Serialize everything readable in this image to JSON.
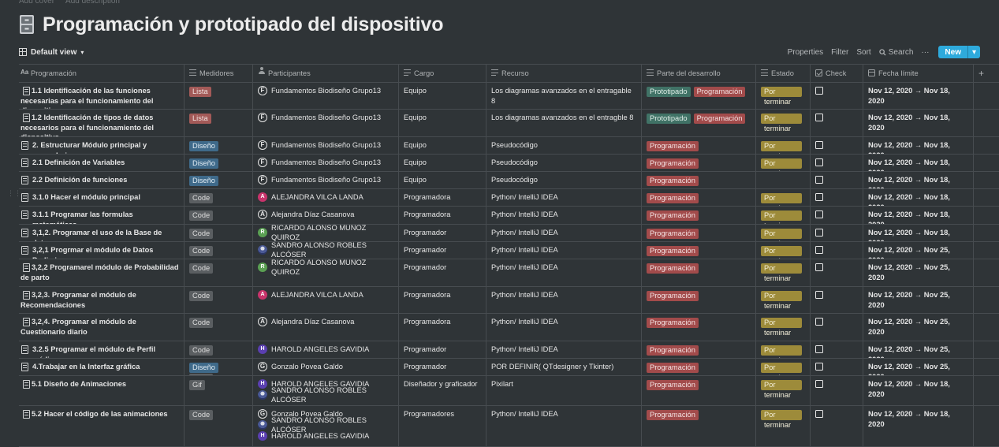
{
  "topbar": {
    "add_cover": "Add cover",
    "add_description": "Add description"
  },
  "page": {
    "title": "Programación y prototipado del dispositivo",
    "icon": "cabinet-icon"
  },
  "view": {
    "name": "Default view",
    "tools": {
      "properties": "Properties",
      "filter": "Filter",
      "sort": "Sort",
      "search": "Search",
      "more": "···",
      "new": "New"
    }
  },
  "columns": [
    "Programación",
    "Medidores",
    "Participantes",
    "Cargo",
    "Recurso",
    "Parte del desarrollo",
    "Estado",
    "Check",
    "Fecha límite",
    "+"
  ],
  "rows": [
    {
      "name": "1.1 Identificación de las funciones necesarias para el funcionamiento del dispositivo",
      "medidores": [
        {
          "label": "Lista",
          "color": "red"
        }
      ],
      "participantes": [
        {
          "name": "Fundamentos Biodiseño Grupo13",
          "avatar": "F",
          "style": "letter"
        }
      ],
      "cargo": "Equipo",
      "recurso": "Los diagramas avanzados en el entragable 8",
      "parte": [
        {
          "label": "Prototipado",
          "color": "green"
        },
        {
          "label": "Programación",
          "color": "prog"
        }
      ],
      "estado": "Por terminar",
      "fecha": "Nov 12, 2020 → Nov 18, 2020",
      "h": 34
    },
    {
      "name": "1.2 Identificación de tipos de datos necesarios para el funcionamiento del dispositivo",
      "medidores": [
        {
          "label": "Lista",
          "color": "red"
        }
      ],
      "participantes": [
        {
          "name": "Fundamentos Biodiseño Grupo13",
          "avatar": "F",
          "style": "letter"
        }
      ],
      "cargo": "Equipo",
      "recurso": "Los diagramas avanzados en el entragble 8",
      "parte": [
        {
          "label": "Prototipado",
          "color": "green"
        },
        {
          "label": "Programación",
          "color": "prog"
        }
      ],
      "estado": "Por terminar",
      "fecha": "Nov 12, 2020 → Nov 18, 2020",
      "h": 35
    },
    {
      "name": "2. Estructurar Módulo principal y secundarios",
      "medidores": [
        {
          "label": "Diseño",
          "color": "blue"
        }
      ],
      "participantes": [
        {
          "name": "Fundamentos Biodiseño Grupo13",
          "avatar": "F",
          "style": "letter"
        }
      ],
      "cargo": "Equipo",
      "recurso": "Pseudocódigo",
      "parte": [
        {
          "label": "Programación",
          "color": "prog"
        }
      ],
      "estado": "Por terminar",
      "fecha": "Nov 12, 2020 → Nov 18, 2020",
      "h": 22
    },
    {
      "name": "2.1 Definición de Variables",
      "medidores": [
        {
          "label": "Diseño",
          "color": "blue"
        }
      ],
      "participantes": [
        {
          "name": "Fundamentos Biodiseño Grupo13",
          "avatar": "F",
          "style": "letter"
        }
      ],
      "cargo": "Equipo",
      "recurso": "Pseudocódigo",
      "parte": [
        {
          "label": "Programación",
          "color": "prog"
        }
      ],
      "estado": "Por terminar",
      "fecha": "Nov 12, 2020 → Nov 18, 2020",
      "h": 22
    },
    {
      "name": "2.2 Definición de funciones",
      "medidores": [
        {
          "label": "Diseño",
          "color": "blue"
        }
      ],
      "participantes": [
        {
          "name": "Fundamentos Biodiseño Grupo13",
          "avatar": "F",
          "style": "letter"
        }
      ],
      "cargo": "Equipo",
      "recurso": "Pseudocódigo",
      "parte": [
        {
          "label": "Programación",
          "color": "prog"
        }
      ],
      "estado": "",
      "fecha": "Nov 12, 2020 → Nov 18, 2020",
      "h": 22
    },
    {
      "name": "3.1.0 Hacer el módulo principal",
      "medidores": [
        {
          "label": "Code",
          "color": "gray"
        }
      ],
      "participantes": [
        {
          "name": "ALEJANDRA VILCA LANDA",
          "avatar": "A",
          "style": "pink"
        }
      ],
      "cargo": "Programadora",
      "recurso": "Python/ IntelliJ IDEA",
      "parte": [
        {
          "label": "Programación",
          "color": "prog"
        }
      ],
      "estado": "Por terminar",
      "fecha": "Nov 12, 2020 → Nov 18, 2020",
      "h": 22
    },
    {
      "name": "3.1.1 Programar las formulas matemáticas",
      "medidores": [
        {
          "label": "Code",
          "color": "gray"
        }
      ],
      "participantes": [
        {
          "name": "Alejandra Díaz Casanova",
          "avatar": "A",
          "style": "letter"
        }
      ],
      "cargo": "Programadora",
      "recurso": "Python/ IntelliJ IDEA",
      "parte": [
        {
          "label": "Programación",
          "color": "prog"
        }
      ],
      "estado": "Por terminar",
      "fecha": "Nov 12, 2020 → Nov 18, 2020",
      "h": 23
    },
    {
      "name": "3,1,2. Programar el uso de la Base de datos",
      "medidores": [
        {
          "label": "Code",
          "color": "gray"
        }
      ],
      "participantes": [
        {
          "name": "RICARDO ALONSO MUÑOZ QUIROZ",
          "avatar": "R",
          "style": "green"
        }
      ],
      "cargo": "Programador",
      "recurso": "Python/ IntelliJ IDEA",
      "parte": [
        {
          "label": "Programación",
          "color": "prog"
        }
      ],
      "estado": "Por terminar",
      "fecha": "Nov 12, 2020 → Nov 18, 2020",
      "h": 22
    },
    {
      "name": "3,2,1 Progrmar el módulo de Datos Preliminares",
      "medidores": [
        {
          "label": "Code",
          "color": "gray"
        }
      ],
      "participantes": [
        {
          "name": "SANDRO ALONSO ROBLES ALCÓSER",
          "avatar": "",
          "style": "photo"
        }
      ],
      "cargo": "Programador",
      "recurso": "Python/ IntelliJ IDEA",
      "parte": [
        {
          "label": "Programación",
          "color": "prog"
        }
      ],
      "estado": "Por terminar",
      "fecha": "Nov 12, 2020 → Nov 25, 2020",
      "h": 22
    },
    {
      "name": "3,2,2 Programarel módulo de Probabilidad de parto",
      "medidores": [
        {
          "label": "Code",
          "color": "gray"
        }
      ],
      "participantes": [
        {
          "name": "RICARDO ALONSO MUÑOZ QUIROZ",
          "avatar": "R",
          "style": "green"
        }
      ],
      "cargo": "Programador",
      "recurso": "Python/ IntelliJ IDEA",
      "parte": [
        {
          "label": "Programación",
          "color": "prog"
        }
      ],
      "estado": "Por terminar",
      "fecha": "Nov 12, 2020 → Nov 25, 2020",
      "h": 35
    },
    {
      "name": "3,2,3. Programar el módulo de Recomendaciones",
      "medidores": [
        {
          "label": "Code",
          "color": "gray"
        }
      ],
      "participantes": [
        {
          "name": "ALEJANDRA VILCA LANDA",
          "avatar": "A",
          "style": "pink"
        }
      ],
      "cargo": "Programadora",
      "recurso": "Python/ IntelliJ IDEA",
      "parte": [
        {
          "label": "Programación",
          "color": "prog"
        }
      ],
      "estado": "Por terminar",
      "fecha": "Nov 12, 2020 → Nov 25, 2020",
      "h": 34
    },
    {
      "name": "3,2,4. Programar el módulo de Cuestionario diario",
      "medidores": [
        {
          "label": "Code",
          "color": "gray"
        }
      ],
      "participantes": [
        {
          "name": "Alejandra Díaz Casanova",
          "avatar": "A",
          "style": "letter"
        }
      ],
      "cargo": "Programadora",
      "recurso": "Python/ IntelliJ IDEA",
      "parte": [
        {
          "label": "Programación",
          "color": "prog"
        }
      ],
      "estado": "Por terminar",
      "fecha": "Nov 12, 2020 → Nov 25, 2020",
      "h": 35
    },
    {
      "name": "3.2.5 Programar el módulo de Perfil médico",
      "medidores": [
        {
          "label": "Code",
          "color": "gray"
        }
      ],
      "participantes": [
        {
          "name": "HAROLD ANGELES GAVIDIA",
          "avatar": "H",
          "style": "purple"
        }
      ],
      "cargo": "Programador",
      "recurso": "Python/ IntelliJ IDEA",
      "parte": [
        {
          "label": "Programación",
          "color": "prog"
        }
      ],
      "estado": "Por terminar",
      "fecha": "Nov 12, 2020 → Nov 25, 2020",
      "h": 22
    },
    {
      "name": "4.Trabajar en la Interfaz gráfica",
      "medidores": [
        {
          "label": "Diseño",
          "color": "blue"
        },
        {
          "label": "Code",
          "color": "gray"
        }
      ],
      "participantes": [
        {
          "name": "Gonzalo Povea Galdo",
          "avatar": "G",
          "style": "letter"
        }
      ],
      "cargo": "Programador",
      "recurso": "POR DEFINIR( QTdesigner y Tkinter)",
      "parte": [
        {
          "label": "Programación",
          "color": "prog"
        }
      ],
      "estado": "Por terminar",
      "fecha": "Nov 12, 2020 → Nov 25, 2020",
      "h": 22
    },
    {
      "name": "5.1 Diseño de Animaciones",
      "medidores": [
        {
          "label": "Gif",
          "color": "gray"
        }
      ],
      "participantes": [
        {
          "name": "HAROLD ANGELES GAVIDIA",
          "avatar": "H",
          "style": "purple"
        },
        {
          "name": "SANDRO ALONSO ROBLES ALCÓSER",
          "avatar": "",
          "style": "photo"
        }
      ],
      "cargo": "Diseñador y graficador",
      "recurso": "Pixilart",
      "parte": [
        {
          "label": "Programación",
          "color": "prog"
        }
      ],
      "estado": "Por terminar",
      "fecha": "Nov 12, 2020 → Nov 18, 2020",
      "h": 38
    },
    {
      "name": "5.2 Hacer el código de las animaciones",
      "medidores": [
        {
          "label": "Code",
          "color": "gray"
        }
      ],
      "participantes": [
        {
          "name": "Gonzalo Povea Galdo",
          "avatar": "G",
          "style": "letter"
        },
        {
          "name": "SANDRO ALONSO ROBLES ALCÓSER",
          "avatar": "",
          "style": "photo"
        },
        {
          "name": "HAROLD ANGELES GAVIDIA",
          "avatar": "H",
          "style": "purple"
        }
      ],
      "cargo": "Programadores",
      "recurso": "Python/ IntelliJ IDEA",
      "parte": [
        {
          "label": "Programación",
          "color": "prog"
        }
      ],
      "estado": "Por terminar",
      "fecha": "Nov 12, 2020 → Nov 18, 2020",
      "h": 52
    }
  ]
}
